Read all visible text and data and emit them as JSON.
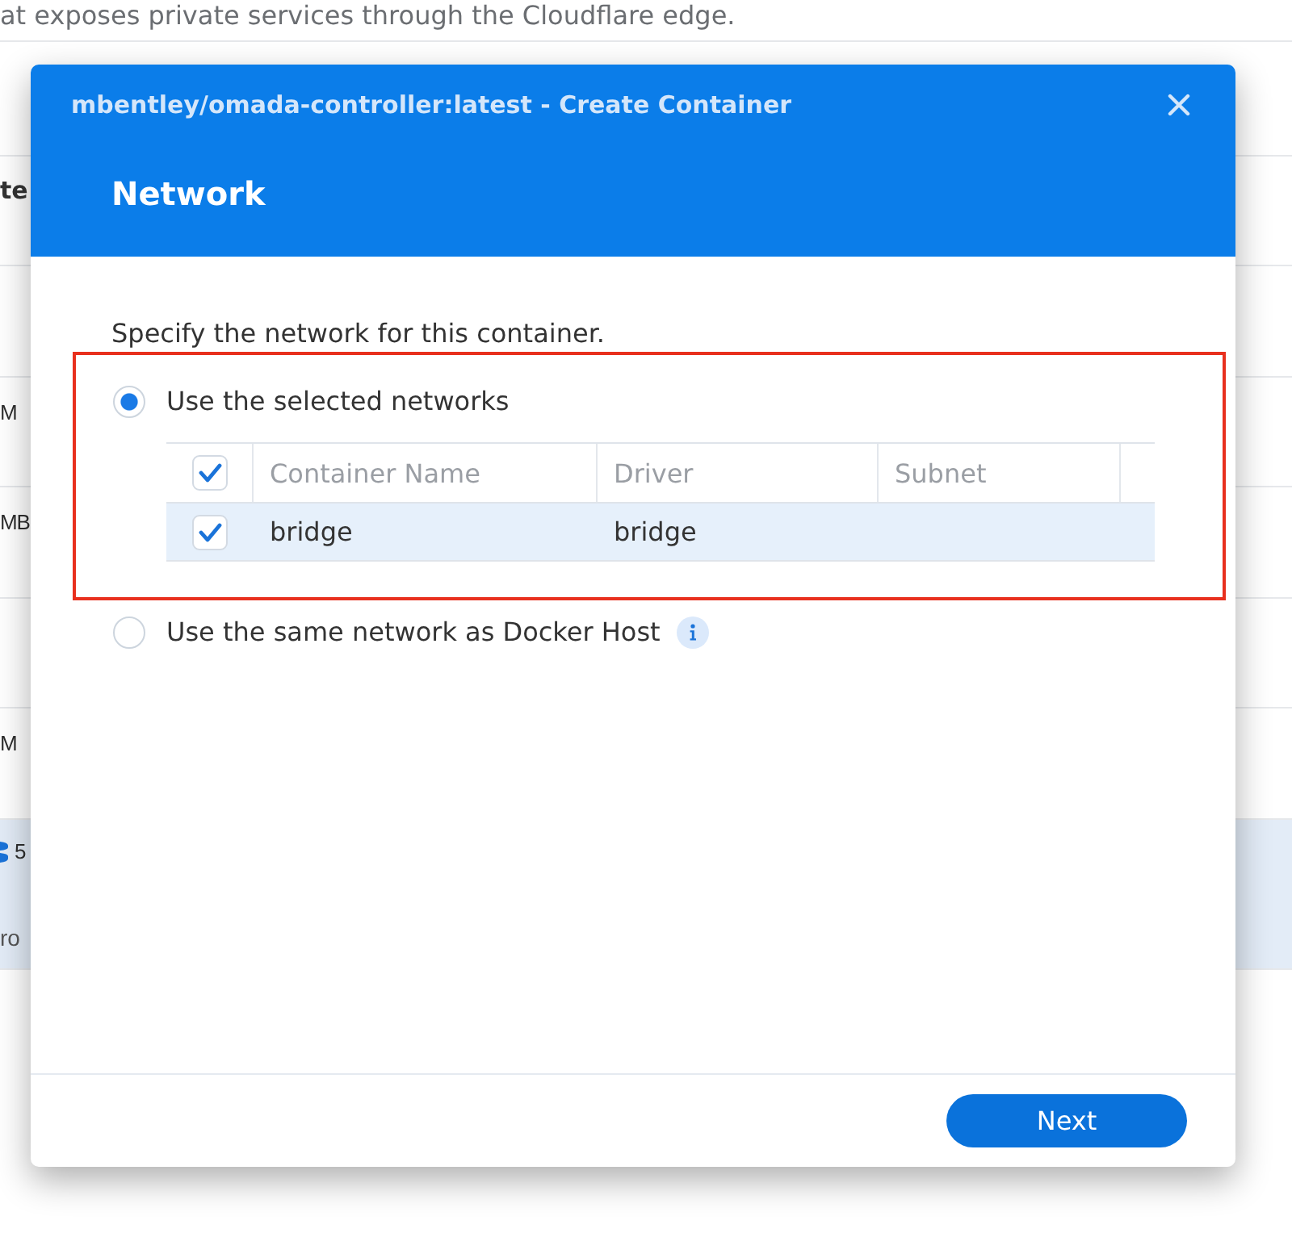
{
  "background": {
    "description": "at exposes private services through the Cloudflare edge.",
    "table": {
      "header": "te",
      "rows": [
        {
          "kind": "blank",
          "selected": false
        },
        {
          "kind": "text",
          "selected": false,
          "cell": "M"
        },
        {
          "kind": "text",
          "selected": false,
          "cell": "MB"
        },
        {
          "kind": "blank",
          "selected": false
        },
        {
          "kind": "text",
          "selected": false,
          "cell": "M"
        },
        {
          "kind": "icon_text",
          "selected": true,
          "cell": "5",
          "subtext": "ro"
        }
      ]
    }
  },
  "dialog": {
    "title": "mbentley/omada-controller:latest - Create Container",
    "step_title": "Network",
    "instruction": "Specify the network for this container.",
    "options": [
      {
        "kind": "network_table",
        "label": "Use the selected networks",
        "selected": true,
        "highlighted": true,
        "table": {
          "all_checked": true,
          "columns": [
            "Container Name",
            "Driver",
            "Subnet"
          ],
          "rows": [
            {
              "selected": true,
              "checked": true,
              "cells": [
                "bridge",
                "bridge"
              ]
            }
          ]
        }
      },
      {
        "kind": "plain",
        "label": "Use the same network as Docker Host",
        "selected": false,
        "highlighted": false,
        "info": true
      }
    ],
    "buttons": [
      {
        "label": "Next",
        "kind": "primary"
      }
    ]
  }
}
